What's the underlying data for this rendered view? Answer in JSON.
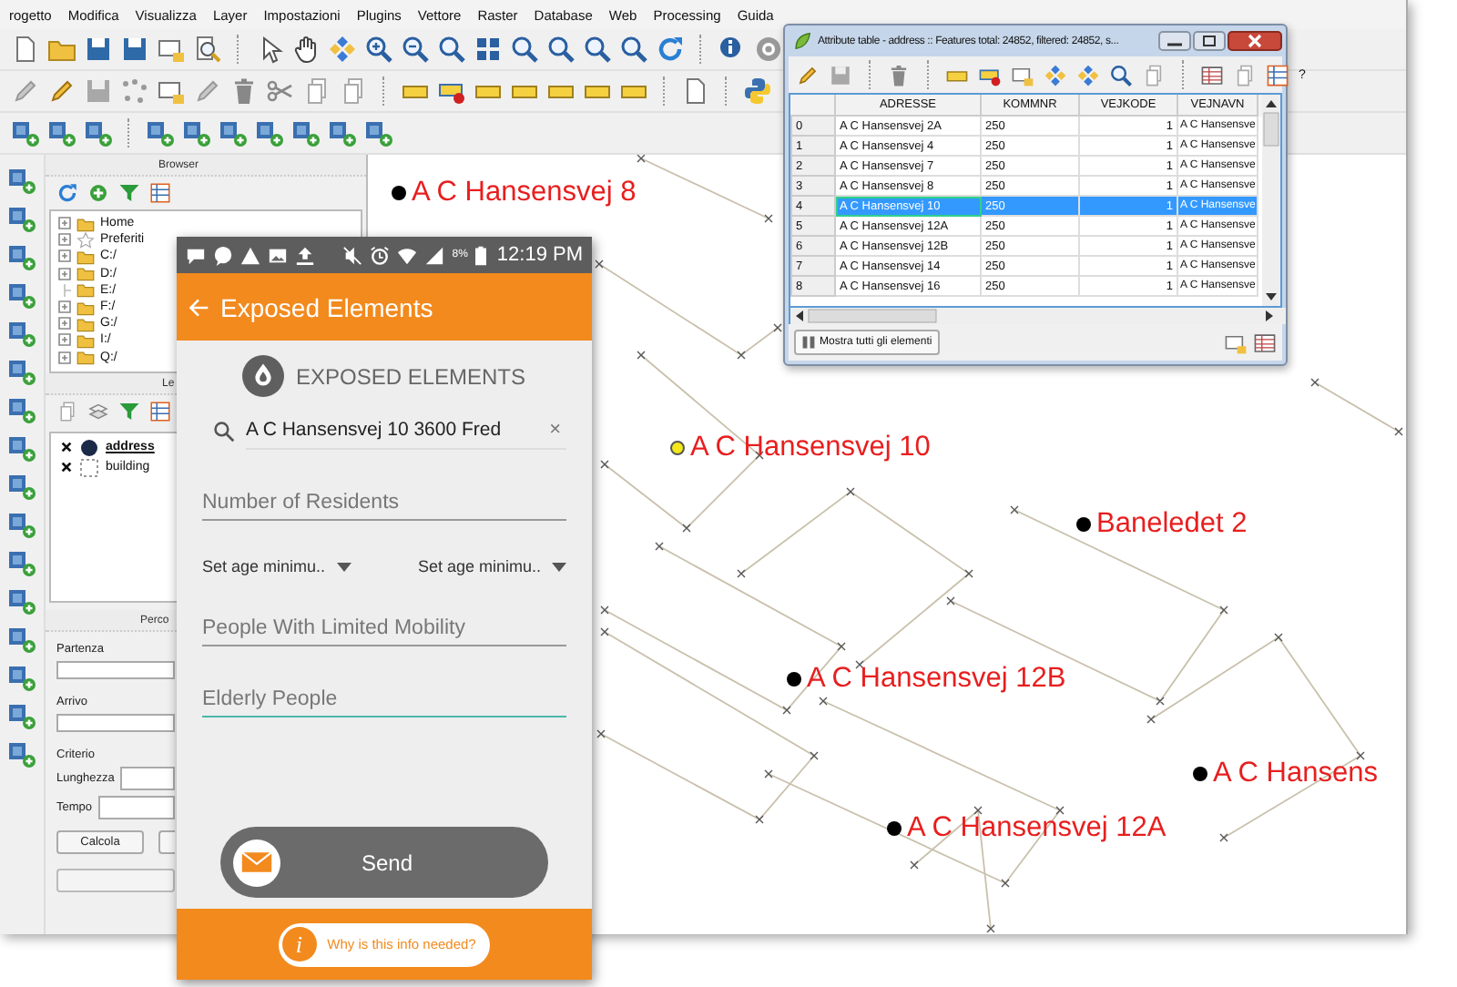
{
  "menu": [
    "rogetto",
    "Modifica",
    "Visualizza",
    "Layer",
    "Impostazioni",
    "Plugins",
    "Vettore",
    "Raster",
    "Database",
    "Web",
    "Processing",
    "Guida"
  ],
  "browser": {
    "title": "Browser",
    "items": [
      {
        "label": "Home",
        "kind": "folder",
        "expandable": true
      },
      {
        "label": "Preferiti",
        "kind": "star",
        "expandable": true
      },
      {
        "label": "C:/",
        "kind": "folder",
        "expandable": true
      },
      {
        "label": "D:/",
        "kind": "folder",
        "expandable": true
      },
      {
        "label": "E:/",
        "kind": "folder",
        "expandable": false
      },
      {
        "label": "F:/",
        "kind": "folder",
        "expandable": true
      },
      {
        "label": "G:/",
        "kind": "folder",
        "expandable": true
      },
      {
        "label": "I:/",
        "kind": "folder",
        "expandable": true
      },
      {
        "label": "Q:/",
        "kind": "folder",
        "expandable": true
      }
    ]
  },
  "layers": {
    "title": "Le",
    "items": [
      {
        "name": "address",
        "kind": "point",
        "checked": true,
        "selected": true
      },
      {
        "name": "building",
        "kind": "polygon",
        "checked": true,
        "selected": false
      }
    ]
  },
  "route": {
    "title": "Perco",
    "fields": [
      {
        "label": "Partenza",
        "kind": "stacked"
      },
      {
        "label": "Arrivo",
        "kind": "stacked"
      },
      {
        "label": "Criterio",
        "kind": "heading"
      },
      {
        "label": "Lunghezza",
        "kind": "inline"
      },
      {
        "label": "Tempo",
        "kind": "inline"
      }
    ],
    "button": "Calcola"
  },
  "map": {
    "labels": [
      {
        "text": "A C Hansensvej 8",
        "highlighted": false
      },
      {
        "text": "A C Hansensvej 10",
        "highlighted": true
      },
      {
        "text": "Baneledet 2",
        "highlighted": false
      },
      {
        "text": "A C Hansensvej 12B",
        "highlighted": false
      },
      {
        "text": "A C Hansensvej 12A",
        "highlighted": false
      },
      {
        "text": "A C Hansens",
        "highlighted": false
      }
    ]
  },
  "attribute_table": {
    "title": "Attribute table - address :: Features total: 24852, filtered: 24852, s...",
    "help": "?",
    "columns": [
      "ADRESSE",
      "KOMMNR",
      "VEJKODE",
      "VEJNAVN"
    ],
    "rows": [
      {
        "index": "0",
        "cells": [
          "A C Hansensvej 2A",
          "250",
          "1",
          "A C Hansensve"
        ],
        "selected": false
      },
      {
        "index": "1",
        "cells": [
          "A C Hansensvej 4",
          "250",
          "1",
          "A C Hansensve"
        ],
        "selected": false
      },
      {
        "index": "2",
        "cells": [
          "A C Hansensvej 7",
          "250",
          "1",
          "A C Hansensve"
        ],
        "selected": false
      },
      {
        "index": "3",
        "cells": [
          "A C Hansensvej 8",
          "250",
          "1",
          "A C Hansensve"
        ],
        "selected": false
      },
      {
        "index": "4",
        "cells": [
          "A C Hansensvej 10",
          "250",
          "1",
          "A C Hansensve"
        ],
        "selected": true
      },
      {
        "index": "5",
        "cells": [
          "A C Hansensvej 12A",
          "250",
          "1",
          "A C Hansensve"
        ],
        "selected": false
      },
      {
        "index": "6",
        "cells": [
          "A C Hansensvej 12B",
          "250",
          "1",
          "A C Hansensve"
        ],
        "selected": false
      },
      {
        "index": "7",
        "cells": [
          "A C Hansensvej 14",
          "250",
          "1",
          "A C Hansensve"
        ],
        "selected": false
      },
      {
        "index": "8",
        "cells": [
          "A C Hansensvej 16",
          "250",
          "1",
          "A C Hansensve"
        ],
        "selected": false
      }
    ],
    "button": "Mostra tutti gli elementi"
  },
  "phone": {
    "time": "12:19 PM",
    "battery": "8%",
    "header": "Exposed Elements",
    "section_title": "EXPOSED ELEMENTS",
    "search": {
      "value": "A C Hansensvej 10 3600 Fred"
    },
    "clear": "×",
    "fields": [
      {
        "kind": "input",
        "placeholder": "Number of Residents",
        "focused": false
      },
      {
        "kind": "dropdowns",
        "options": [
          "Set age minimu..",
          "Set age minimu.."
        ]
      },
      {
        "kind": "input",
        "placeholder": "People With Limited Mobility",
        "focused": false
      },
      {
        "kind": "input",
        "placeholder": "Elderly People",
        "focused": true
      }
    ],
    "send": "Send",
    "info_icon": "i",
    "info_link": "Why is this info needed?"
  }
}
